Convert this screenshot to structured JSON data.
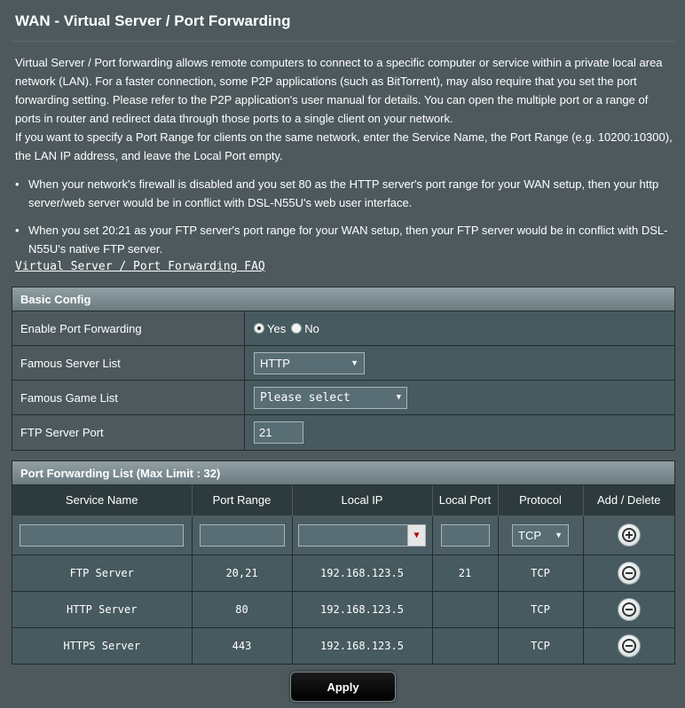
{
  "page": {
    "title": "WAN - Virtual Server / Port Forwarding",
    "description": [
      "Virtual Server / Port forwarding allows remote computers to connect to a specific computer or service within a private local area network (LAN). For a faster connection, some P2P applications (such as BitTorrent), may also require that you set the port forwarding setting. Please refer to the P2P application's user manual for details. You can open the multiple port or a range of ports in router and redirect data through those ports to a single client on your network.",
      "If you want to specify a Port Range for clients on the same network, enter the Service Name, the Port Range (e.g. 10200:10300), the LAN IP address, and leave the Local Port empty."
    ],
    "bullets": [
      "When your network's firewall is disabled and you set 80 as the HTTP server's port range for your WAN setup, then your http server/web server would be in conflict with DSL-N55U's web user interface.",
      "When you set 20:21 as your FTP server's port range for your WAN setup, then your FTP server would be in conflict with DSL-N55U's native FTP server."
    ],
    "faq_link": "Virtual Server / Port Forwarding FAQ"
  },
  "basic_config": {
    "header": "Basic Config",
    "enable_label": "Enable Port Forwarding",
    "yes_label": "Yes",
    "no_label": "No",
    "enable_selected": "Yes",
    "server_list_label": "Famous Server List",
    "server_list_value": "HTTP",
    "game_list_label": "Famous Game List",
    "game_list_value": "Please select",
    "ftp_port_label": "FTP Server Port",
    "ftp_port_value": "21"
  },
  "pf_list": {
    "header": "Port Forwarding List (Max Limit : 32)",
    "columns": [
      "Service Name",
      "Port Range",
      "Local IP",
      "Local Port",
      "Protocol",
      "Add / Delete"
    ],
    "new_protocol": "TCP",
    "rows": [
      {
        "service": "FTP Server",
        "port_range": "20,21",
        "local_ip": "192.168.123.5",
        "local_port": "21",
        "protocol": "TCP"
      },
      {
        "service": "HTTP Server",
        "port_range": "80",
        "local_ip": "192.168.123.5",
        "local_port": "",
        "protocol": "TCP"
      },
      {
        "service": "HTTPS Server",
        "port_range": "443",
        "local_ip": "192.168.123.5",
        "local_port": "",
        "protocol": "TCP"
      }
    ]
  },
  "apply_label": "Apply",
  "icons": {
    "add": "plus-circle-icon",
    "delete": "minus-circle-icon",
    "dropdown": "triangle-down-icon"
  },
  "colors": {
    "background": "#4d595d",
    "header_gradient_top": "#92a0a5",
    "apply_button": "#000000"
  }
}
